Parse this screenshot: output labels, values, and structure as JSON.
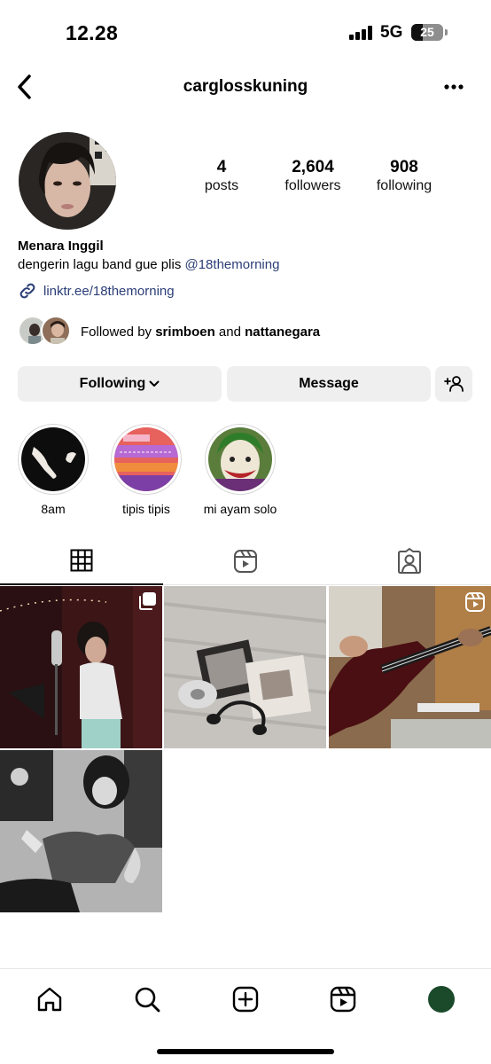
{
  "status_bar": {
    "time": "12.28",
    "network": "5G",
    "battery": "25"
  },
  "header": {
    "username": "carglosskuning"
  },
  "profile": {
    "stats": [
      {
        "value": "4",
        "label": "posts"
      },
      {
        "value": "2,604",
        "label": "followers"
      },
      {
        "value": "908",
        "label": "following"
      }
    ],
    "name": "Menara Inggil",
    "bio_text": "dengerin lagu band gue plis ",
    "bio_mention": "@18themorning",
    "link": "linktr.ee/18themorning",
    "followed_by": {
      "prefix": "Followed by ",
      "user1": "srimboen",
      "and": " and ",
      "user2": "nattanegara"
    }
  },
  "buttons": {
    "following": "Following",
    "message": "Message"
  },
  "highlights": [
    {
      "label": "8am"
    },
    {
      "label": "tipis tipis"
    },
    {
      "label": "mi ayam solo"
    }
  ],
  "tabs": [
    "grid-icon",
    "reels-icon",
    "tagged-icon"
  ],
  "grid": [
    {
      "name": "post-recording-studio",
      "overlay": "carousel-icon"
    },
    {
      "name": "post-cd-player"
    },
    {
      "name": "post-bass-guitar",
      "overlay": "reel-icon"
    },
    {
      "name": "post-portrait-bw"
    }
  ],
  "bottom_nav": [
    "home-icon",
    "search-icon",
    "create-icon",
    "reels-icon",
    "profile-avatar"
  ],
  "colors": {
    "link": "#2b3e78",
    "button_bg": "#efefef",
    "profile_nav": "#1a4a2a"
  }
}
